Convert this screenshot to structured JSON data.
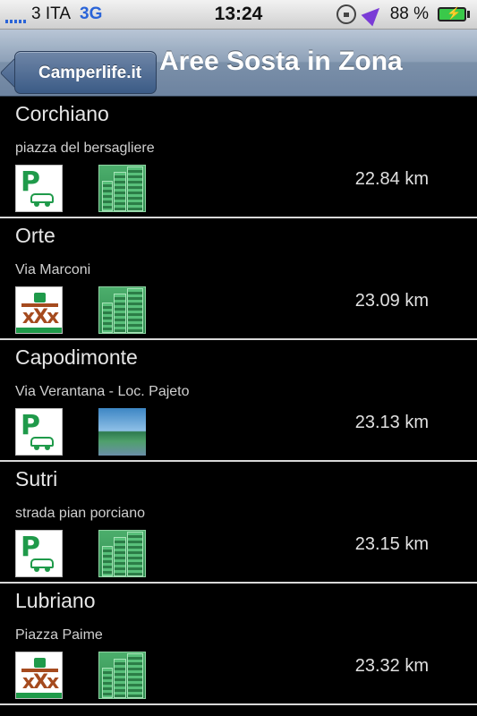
{
  "status_bar": {
    "carrier": "3 ITA",
    "network": "3G",
    "time": "13:24",
    "battery": "88 %",
    "battery_level": 0.88
  },
  "nav": {
    "back_label": "Camperlife.it",
    "title": "Aree Sosta in Zona"
  },
  "list": [
    {
      "name": "Corchiano",
      "address": "piazza del bersagliere",
      "distance": "22.84 km",
      "icon1": "parking-icon",
      "icon2": "city-icon"
    },
    {
      "name": "Orte",
      "address": "Via Marconi",
      "distance": "23.09 km",
      "icon1": "picnic-icon",
      "icon2": "city-icon"
    },
    {
      "name": "Capodimonte",
      "address": "Via Verantana - Loc. Pajeto",
      "distance": "23.13 km",
      "icon1": "parking-icon",
      "icon2": "lake-icon"
    },
    {
      "name": "Sutri",
      "address": "strada pian porciano",
      "distance": "23.15 km",
      "icon1": "parking-icon",
      "icon2": "city-icon"
    },
    {
      "name": "Lubriano",
      "address": "Piazza Paime",
      "distance": "23.32 km",
      "icon1": "picnic-icon",
      "icon2": "city-icon"
    }
  ]
}
